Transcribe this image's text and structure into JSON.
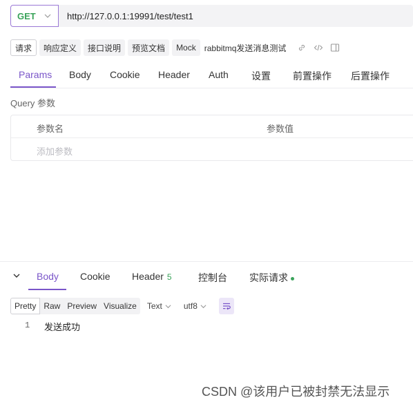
{
  "request": {
    "method": "GET",
    "url": "http://127.0.0.1:19991/test/test1"
  },
  "doc_tabs": [
    {
      "label": "请求",
      "active": true
    },
    {
      "label": "响应定义",
      "active": false
    },
    {
      "label": "接口说明",
      "active": false
    },
    {
      "label": "预览文档",
      "active": false
    },
    {
      "label": "Mock",
      "active": false
    }
  ],
  "doc_title": "rabbitmq发送消息测试",
  "req_tabs": [
    {
      "label": "Params",
      "active": true
    },
    {
      "label": "Body",
      "active": false
    },
    {
      "label": "Cookie",
      "active": false
    },
    {
      "label": "Header",
      "active": false
    },
    {
      "label": "Auth",
      "active": false
    },
    {
      "label": "设置",
      "active": false
    },
    {
      "label": "前置操作",
      "active": false
    },
    {
      "label": "后置操作",
      "active": false
    }
  ],
  "query": {
    "title": "Query 参数",
    "col_name": "参数名",
    "col_value": "参数值",
    "add_placeholder": "添加参数"
  },
  "response": {
    "tabs": [
      {
        "label": "Body",
        "active": true
      },
      {
        "label": "Cookie",
        "active": false
      },
      {
        "label": "Header",
        "active": false,
        "count": "5"
      },
      {
        "label": "控制台",
        "active": false
      },
      {
        "label": "实际请求",
        "active": false
      }
    ],
    "formats": [
      "Pretty",
      "Raw",
      "Preview",
      "Visualize"
    ],
    "active_format": "Pretty",
    "type_select": "Text",
    "encoding_select": "utf8",
    "line_number": "1",
    "body": "发送成功"
  },
  "watermark": "CSDN @该用户已被封禁无法显示",
  "colors": {
    "accent": "#7a55c9",
    "method_get": "#3aa35a",
    "status_dot": "#3aa35a"
  }
}
